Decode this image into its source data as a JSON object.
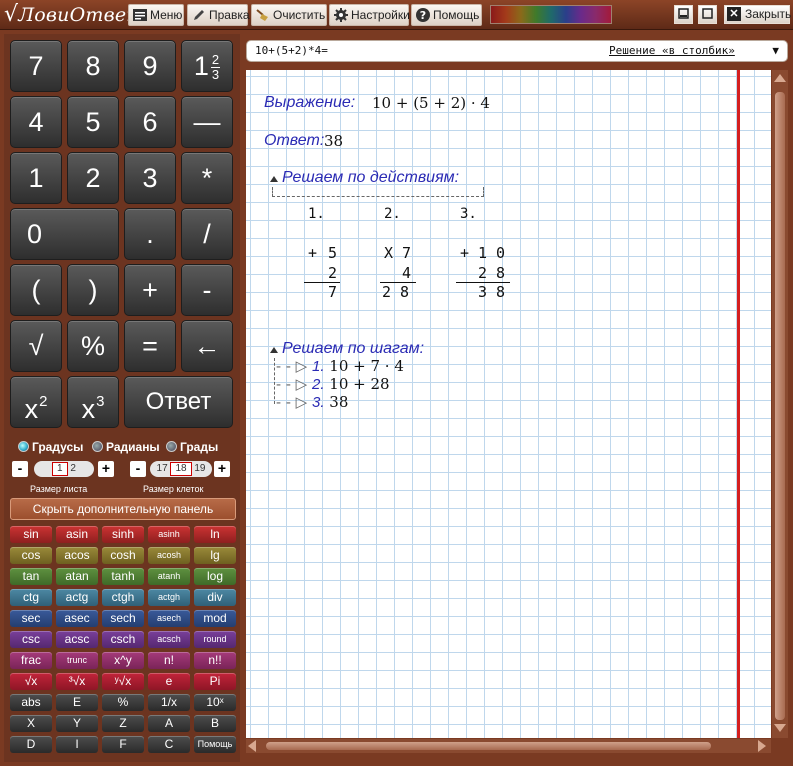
{
  "app": {
    "logo": "ЛовиОтвет",
    "menu": [
      {
        "label": "Меню",
        "icon": "menu-icon"
      },
      {
        "label": "Правка",
        "icon": "pencil-icon"
      },
      {
        "label": "Очистить",
        "icon": "broom-icon"
      },
      {
        "label": "Настройки",
        "icon": "gear-icon"
      },
      {
        "label": "Помощь",
        "icon": "help-icon"
      }
    ],
    "close_label": "Закрыть"
  },
  "keypad": {
    "rows": [
      [
        "7",
        "8",
        "9"
      ],
      [
        "4",
        "5",
        "6",
        "—"
      ],
      [
        "1",
        "2",
        "3",
        "*"
      ],
      [
        "0",
        ".",
        "/"
      ],
      [
        "(",
        ")",
        "+",
        "-"
      ],
      [
        "√",
        "%",
        "=",
        "←"
      ]
    ],
    "mixed_whole": "1",
    "mixed_num": "2",
    "mixed_den": "3",
    "x_squared_base": "x",
    "x_squared_exp": "2",
    "x_cubed_base": "x",
    "x_cubed_exp": "3",
    "answer": "Ответ"
  },
  "angle_modes": [
    {
      "label": "Градусы",
      "selected": true
    },
    {
      "label": "Радианы",
      "selected": false
    },
    {
      "label": "Грады",
      "selected": false
    }
  ],
  "sheet_size": {
    "minus": "-",
    "plus": "+",
    "current": "1",
    "next": "2",
    "label": "Размер листа"
  },
  "cell_size": {
    "minus": "-",
    "plus": "+",
    "prev": "17",
    "current": "18",
    "next": "19",
    "label": "Размер клеток"
  },
  "hide_panel_label": "Скрыть дополнительную панель",
  "function_keys": [
    {
      "color": "r-red",
      "keys": [
        "sin",
        "asin",
        "sinh",
        "asinh",
        "ln"
      ]
    },
    {
      "color": "r-olive",
      "keys": [
        "cos",
        "acos",
        "cosh",
        "acosh",
        "lg"
      ]
    },
    {
      "color": "r-green",
      "keys": [
        "tan",
        "atan",
        "tanh",
        "atanh",
        "log"
      ]
    },
    {
      "color": "r-teal",
      "keys": [
        "ctg",
        "actg",
        "ctgh",
        "actgh",
        "div"
      ]
    },
    {
      "color": "r-navy",
      "keys": [
        "sec",
        "asec",
        "sech",
        "asech",
        "mod"
      ]
    },
    {
      "color": "r-purple",
      "keys": [
        "csc",
        "acsc",
        "csch",
        "acsch",
        "round"
      ]
    },
    {
      "color": "r-magenta",
      "keys": [
        "frac",
        "trunc",
        "x^y",
        "n!",
        "n!!"
      ]
    },
    {
      "color": "r-crimson",
      "keys": [
        "√x",
        "³√x",
        "ʸ√x",
        "e",
        "Pi"
      ]
    },
    {
      "color": "r-dark",
      "keys": [
        "abs",
        "E",
        "%",
        "1/x",
        "10ˣ"
      ]
    },
    {
      "color": "r-dark",
      "keys": [
        "X",
        "Y",
        "Z",
        "A",
        "B"
      ]
    },
    {
      "color": "r-dark",
      "keys": [
        "D",
        "I",
        "F",
        "C",
        "Помощь"
      ]
    }
  ],
  "input": {
    "expression": "10+(5+2)*4=",
    "mode": "Решение «в столбик»"
  },
  "solution": {
    "expression_label": "Выражение:",
    "expression_a": "10 + ",
    "expression_b": "(5 + 2)",
    "expression_c": " · 4",
    "answer_label": "Ответ:",
    "answer_value": "38",
    "by_actions_label": "Решаем по действиям:",
    "actions": [
      {
        "num": "1.",
        "op": "+",
        "top": "5",
        "bottom": "2",
        "result": "7"
      },
      {
        "num": "2.",
        "op": "X",
        "top": "7",
        "bottom": "4",
        "result": "2 8"
      },
      {
        "num": "3.",
        "op": "+",
        "top": "1 0",
        "bottom": "2 8",
        "result": "3 8"
      }
    ],
    "by_steps_label": "Решаем по шагам:",
    "steps": [
      {
        "num": "1.",
        "text": "10 + 7 · 4"
      },
      {
        "num": "2.",
        "text": "10 + 28"
      },
      {
        "num": "3.",
        "text": "38"
      }
    ]
  },
  "colors": {
    "frame": "#7a3a22",
    "margin_line": "#d41f1f",
    "grid": "#bfd7ec",
    "label_blue": "#2b2bb4"
  }
}
